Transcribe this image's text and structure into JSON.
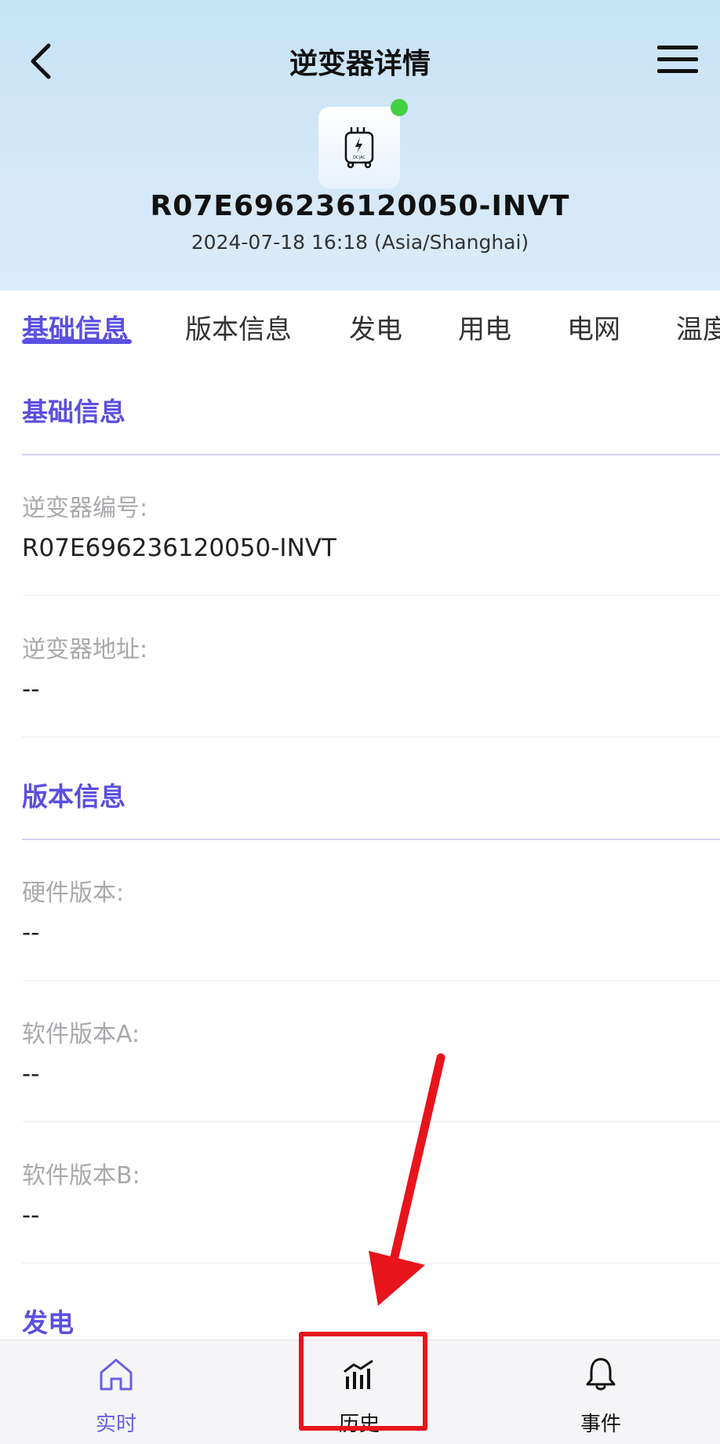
{
  "header": {
    "title": "逆变器详情",
    "device_id": "R07E696236120050-INVT",
    "timestamp": "2024-07-18 16:18 (Asia/Shanghai)",
    "device_icon": "inverter-icon",
    "device_icon_text": "DC|AC",
    "status_color": "#45cf43"
  },
  "tabs": [
    {
      "label": "基础信息",
      "active": true
    },
    {
      "label": "版本信息"
    },
    {
      "label": "发电"
    },
    {
      "label": "用电"
    },
    {
      "label": "电网"
    },
    {
      "label": "温度"
    }
  ],
  "sections": {
    "basic": {
      "title": "基础信息",
      "fields": [
        {
          "label": "逆变器编号:",
          "value": "R07E696236120050-INVT"
        },
        {
          "label": "逆变器地址:",
          "value": "--"
        }
      ]
    },
    "version": {
      "title": "版本信息",
      "fields": [
        {
          "label": "硬件版本:",
          "value": "--"
        },
        {
          "label": "软件版本A:",
          "value": "--"
        },
        {
          "label": "软件版本B:",
          "value": "--"
        }
      ]
    },
    "generation": {
      "title": "发电"
    }
  },
  "bottom_nav": [
    {
      "label": "实时",
      "icon": "home-icon",
      "active": true
    },
    {
      "label": "历史",
      "icon": "bar-chart-icon"
    },
    {
      "label": "事件",
      "icon": "bell-icon"
    }
  ],
  "colors": {
    "accent": "#5b4fe0",
    "highlight": "#e8141c"
  }
}
